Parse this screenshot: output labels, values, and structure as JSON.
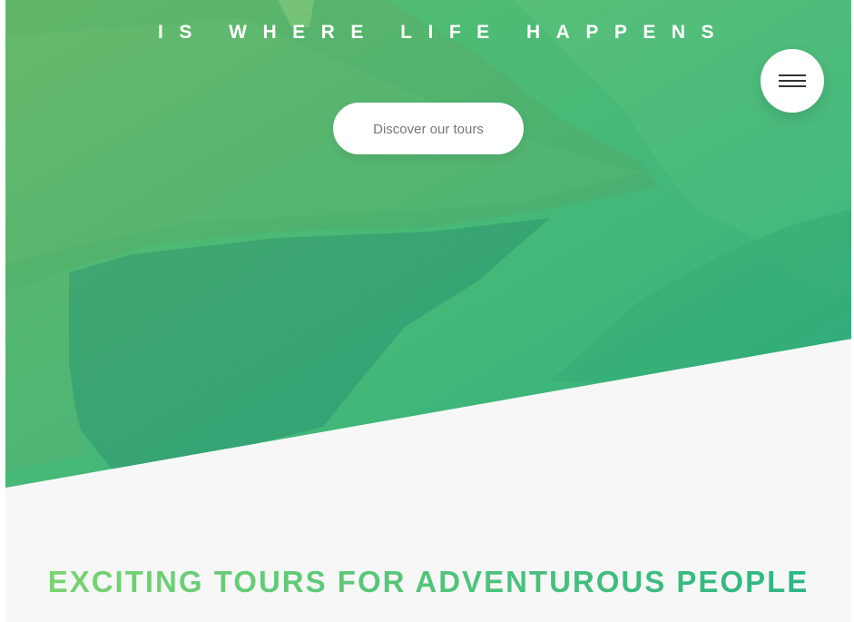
{
  "hero": {
    "tagline": "is where life happens",
    "cta_label": "Discover our tours"
  },
  "nav": {
    "menu_icon": "hamburger-menu-icon"
  },
  "section": {
    "heading": "Exciting tours for adventurous people"
  },
  "colors": {
    "gradient_light": "#7ed56f",
    "gradient_dark": "#28b485",
    "page_background": "#f7f7f7",
    "button_text": "#777777"
  }
}
